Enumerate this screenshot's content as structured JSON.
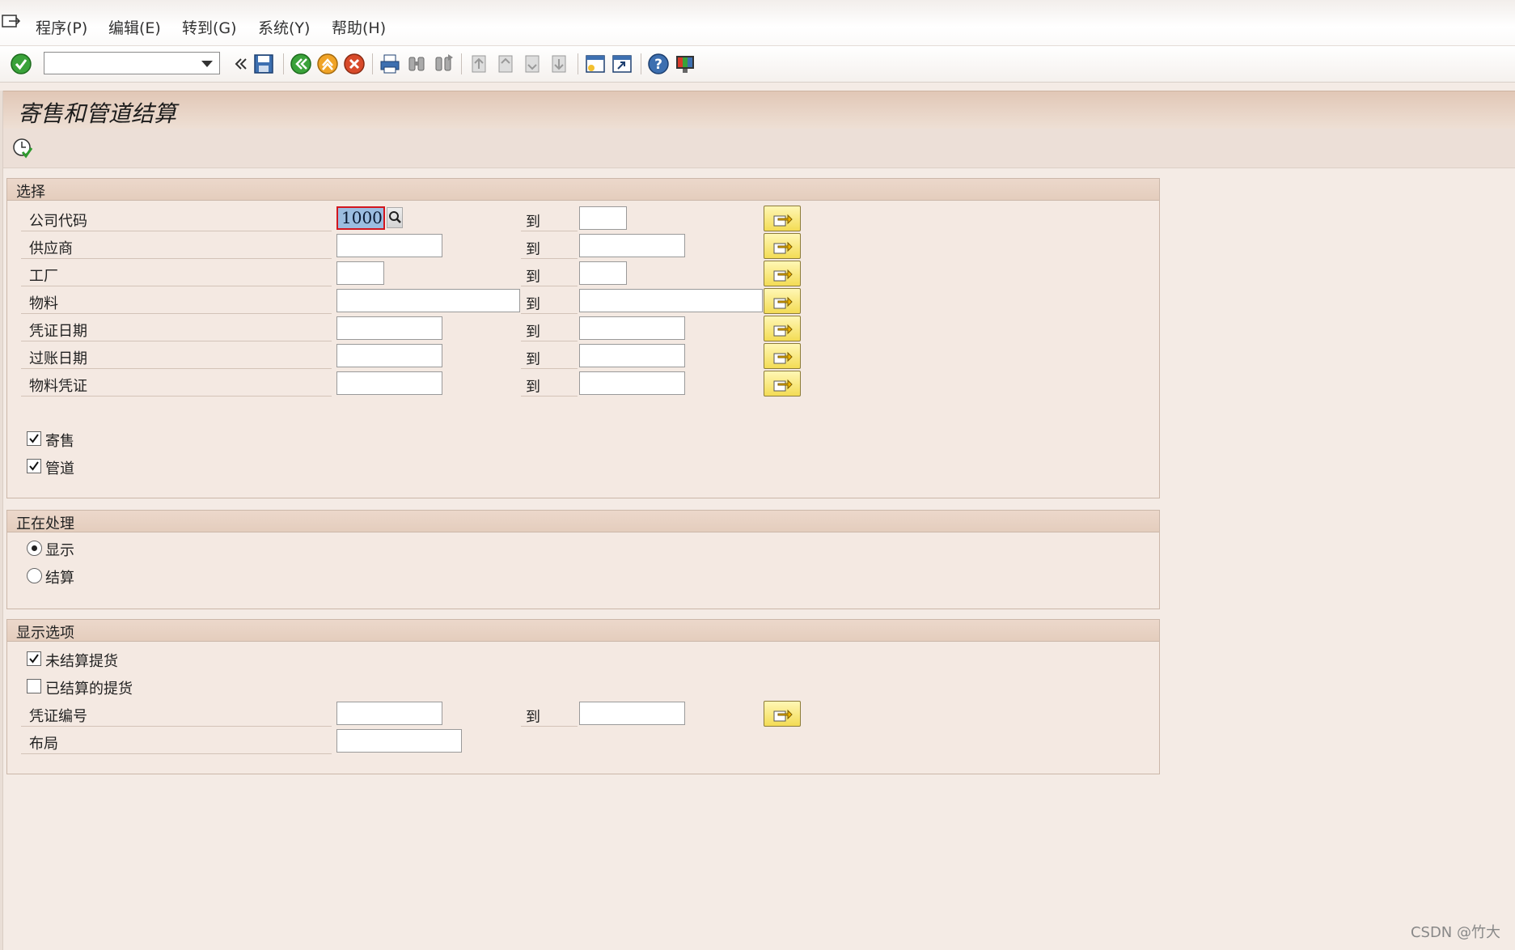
{
  "menu": {
    "items": [
      "程序(P)",
      "编辑(E)",
      "转到(G)",
      "系统(Y)",
      "帮助(H)"
    ]
  },
  "toolbar": {
    "command_value": "",
    "icons": [
      "enter-check-icon",
      "command-dropdown-icon",
      "collapse-icon",
      "save-icon",
      "back-icon",
      "exit-icon",
      "cancel-icon",
      "print-icon",
      "find-icon",
      "find-next-icon",
      "first-page-icon",
      "previous-page-icon",
      "next-page-icon",
      "last-page-icon",
      "new-session-icon",
      "shortcut-icon",
      "help-icon",
      "customize-layout-icon"
    ]
  },
  "title": "寄售和管道结算",
  "selection": {
    "header": "选择",
    "to_label": "到",
    "rows": [
      {
        "label": "公司代码",
        "from": "1000",
        "to": ""
      },
      {
        "label": "供应商",
        "from": "",
        "to": ""
      },
      {
        "label": "工厂",
        "from": "",
        "to": ""
      },
      {
        "label": "物料",
        "from": "",
        "to": ""
      },
      {
        "label": "凭证日期",
        "from": "",
        "to": ""
      },
      {
        "label": "过账日期",
        "from": "",
        "to": ""
      },
      {
        "label": "物料凭证",
        "from": "",
        "to": ""
      }
    ],
    "checkboxes": [
      {
        "label": "寄售",
        "checked": true
      },
      {
        "label": "管道",
        "checked": true
      }
    ]
  },
  "processing": {
    "header": "正在处理",
    "radios": [
      {
        "label": "显示",
        "selected": true
      },
      {
        "label": "结算",
        "selected": false
      }
    ]
  },
  "display_options": {
    "header": "显示选项",
    "checkboxes": [
      {
        "label": "未结算提货",
        "checked": true
      },
      {
        "label": "已结算的提货",
        "checked": false
      }
    ],
    "doc_number": {
      "label": "凭证编号",
      "from": "",
      "to": ""
    },
    "layout": {
      "label": "布局",
      "value": ""
    }
  },
  "watermark": "CSDN @竹大",
  "colors": {
    "accent_yellow": "#f3dc55",
    "title_bar": "#e1c7b6",
    "background": "#f4ebe5",
    "focus_border": "#d2161e"
  }
}
